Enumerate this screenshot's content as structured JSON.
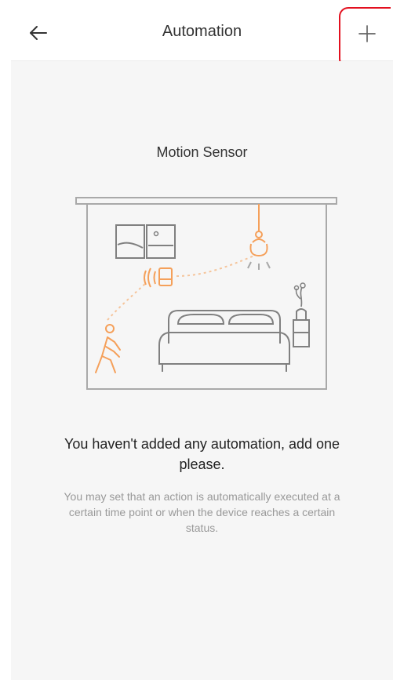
{
  "header": {
    "title": "Automation",
    "back_icon": "arrow-left-icon",
    "add_icon": "plus-icon"
  },
  "main": {
    "device_title": "Motion Sensor",
    "empty_title": "You haven't added any automation, add one please.",
    "empty_description": "You may set that an action is automatically executed at a certain time point or when the device reaches a certain status."
  },
  "colors": {
    "accent": "#f5a05a",
    "highlight": "#e3101f",
    "content_bg": "#f6f6f6"
  }
}
